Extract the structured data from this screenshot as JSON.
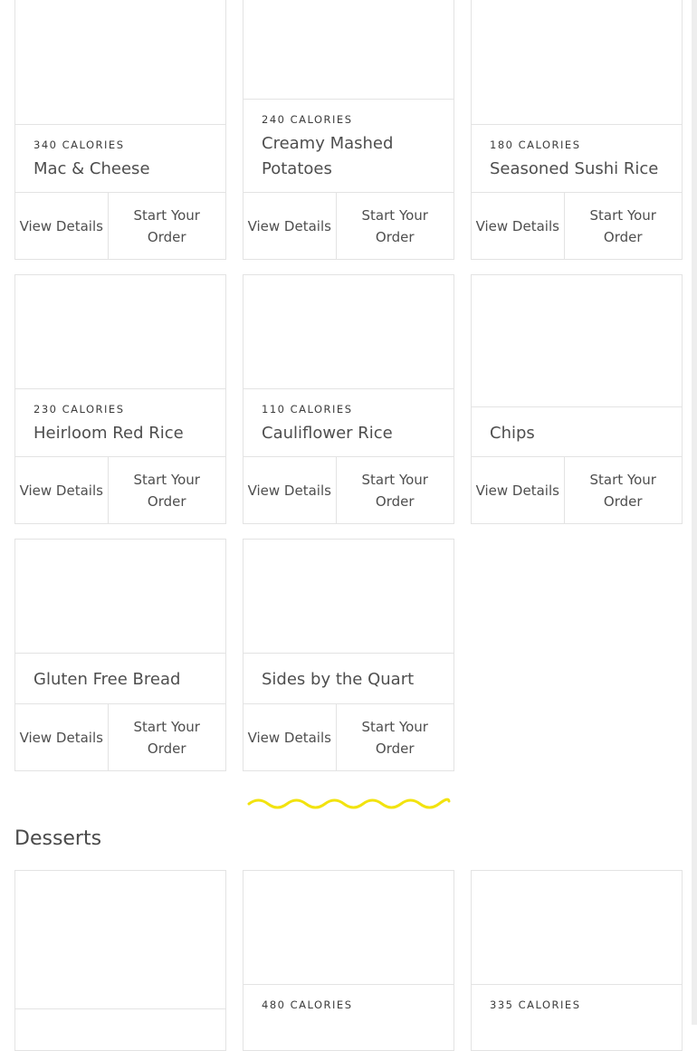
{
  "sides": {
    "items": [
      {
        "calories": "340 CALORIES",
        "name": "Mac & Cheese"
      },
      {
        "calories": "240 CALORIES",
        "name": "Creamy Mashed Potatoes"
      },
      {
        "calories": "180 CALORIES",
        "name": "Seasoned Sushi Rice"
      },
      {
        "calories": "230 CALORIES",
        "name": "Heirloom Red Rice"
      },
      {
        "calories": "110 CALORIES",
        "name": "Cauliflower Rice"
      },
      {
        "calories": "",
        "name": "Chips"
      },
      {
        "calories": "",
        "name": "Gluten Free Bread"
      },
      {
        "calories": "",
        "name": "Sides by the Quart"
      }
    ]
  },
  "buttons": {
    "view_details": "View Details",
    "start_order": "Start Your Order"
  },
  "divider": {
    "color": "#f2e30f",
    "icon": "squiggle-divider"
  },
  "desserts": {
    "title": "Desserts",
    "items": [
      {
        "calories": "",
        "name": ""
      },
      {
        "calories": "480 CALORIES",
        "name": ""
      },
      {
        "calories": "335 CALORIES",
        "name": ""
      }
    ]
  }
}
